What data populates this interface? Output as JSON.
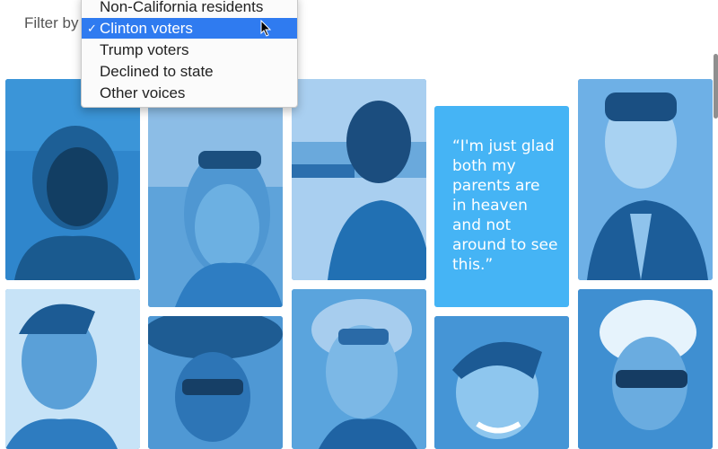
{
  "filter": {
    "label": "Filter by"
  },
  "menu": {
    "options": [
      "Non-California residents",
      "Clinton voters",
      "Trump voters",
      "Declined to state",
      "Other voices"
    ],
    "selected": "Clinton voters"
  },
  "quote": {
    "text": "“I'm just glad both my parents are in heaven and not around to see this.”"
  },
  "colors": {
    "photo_base": "#3a8fd0",
    "quote_bg": "#45b4f5",
    "menu_highlight": "#2f7bf0"
  }
}
